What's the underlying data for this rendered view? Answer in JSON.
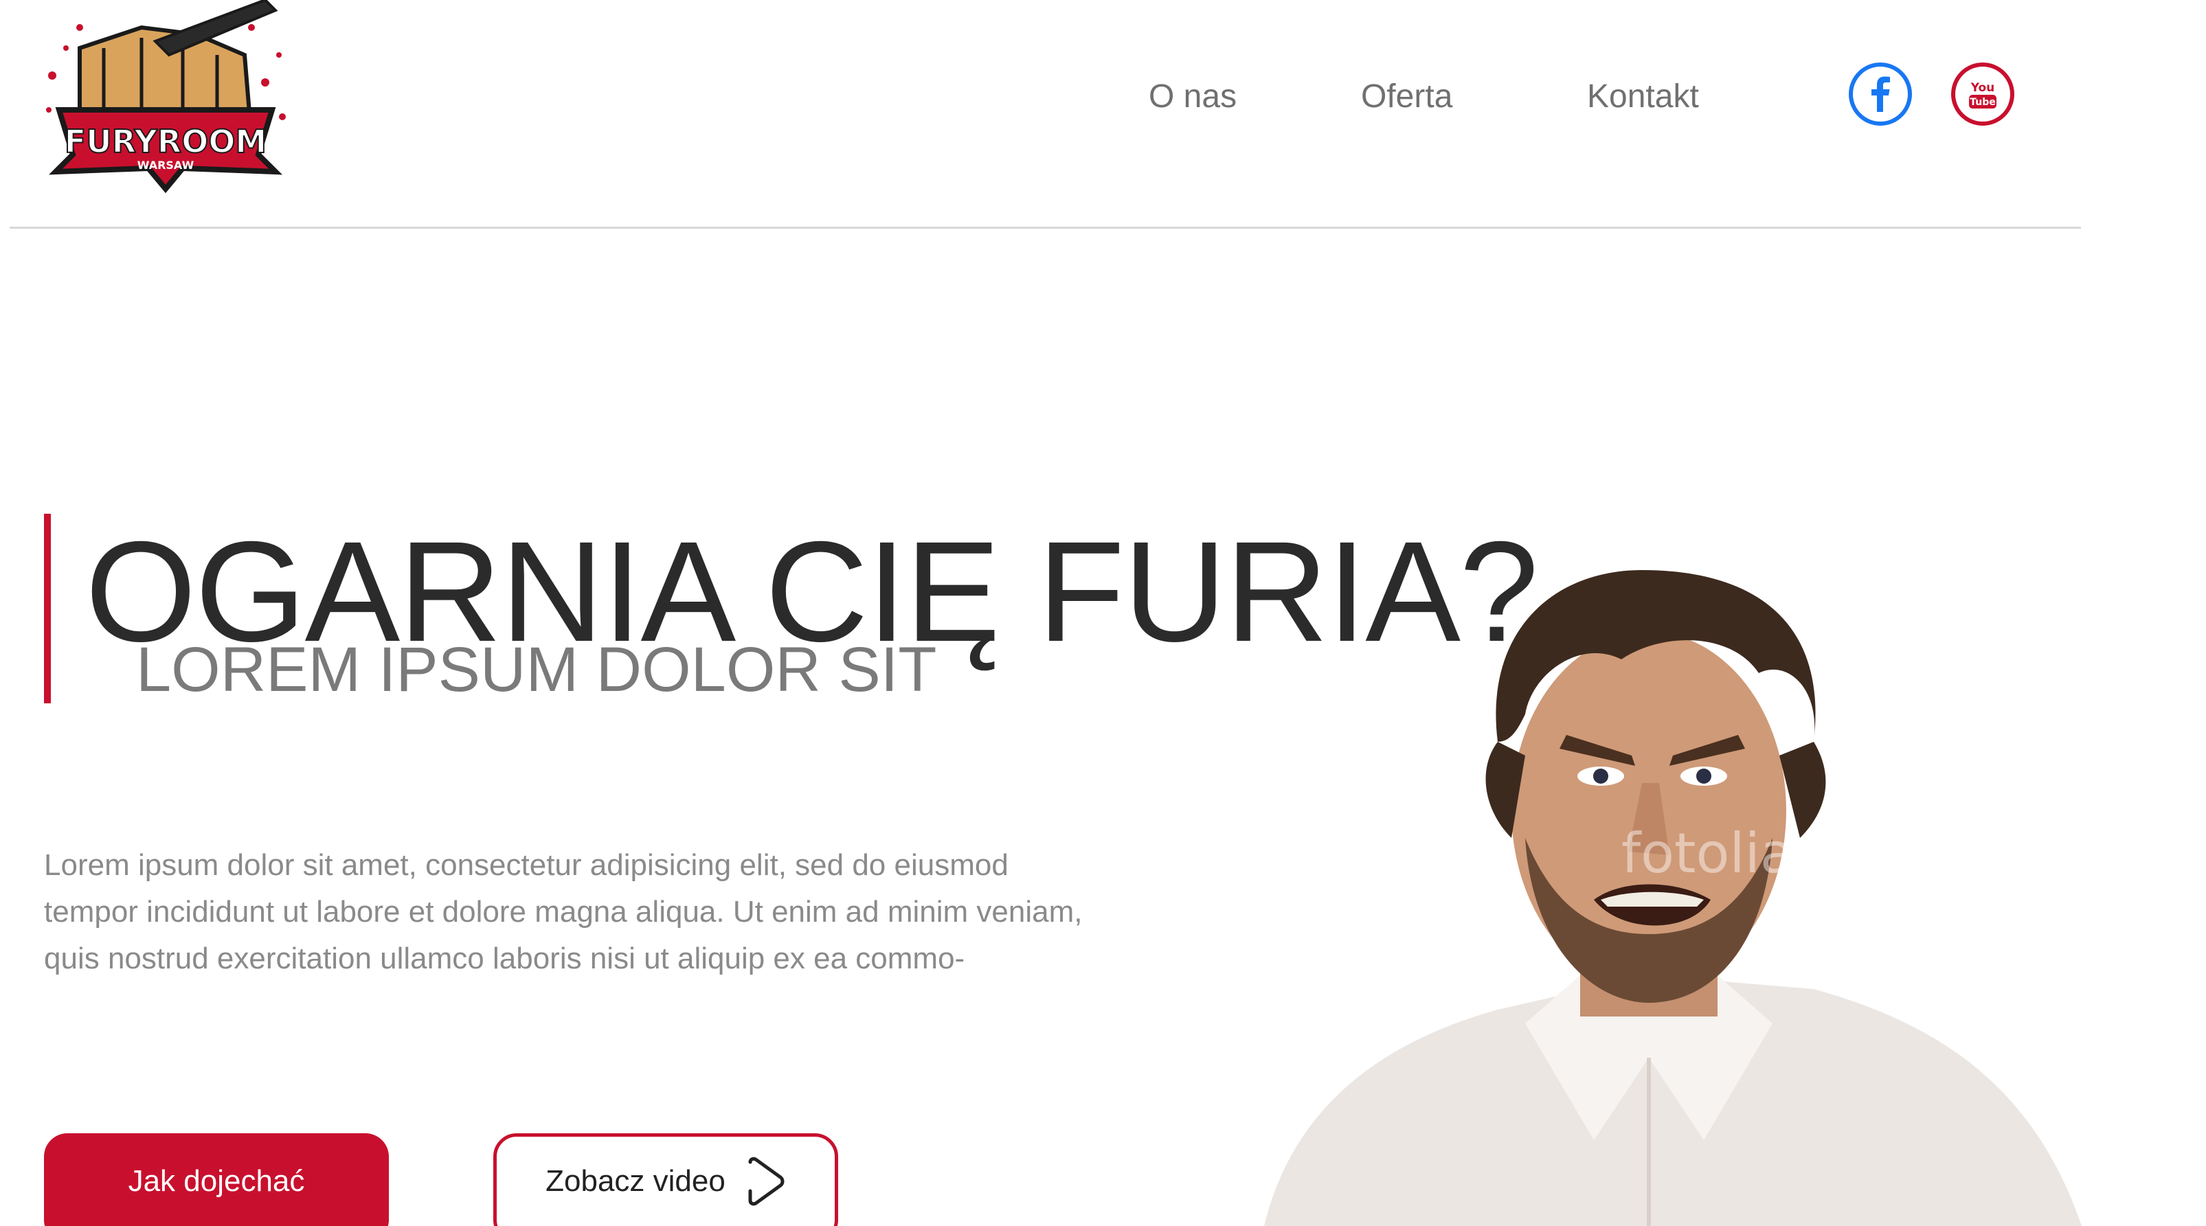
{
  "header": {
    "logo": {
      "text_main": "FURYROOM",
      "text_sub": "WARSAW"
    },
    "nav": [
      {
        "label": "O nas"
      },
      {
        "label": "Oferta"
      },
      {
        "label": "Kontakt"
      }
    ],
    "social": [
      {
        "icon": "facebook-icon",
        "color": "#1877f2"
      },
      {
        "icon": "youtube-icon",
        "color": "#c8102e",
        "text_top": "You",
        "text_bottom": "Tube"
      }
    ]
  },
  "hero": {
    "title": "OGARNIA CIĘ FURIA?",
    "subtitle": "LOREM IPSUM DOLOR SIT",
    "body": "Lorem ipsum dolor sit amet, consectetur adipisicing elit, sed do eiusmod tempor incididunt ut labore et dolore magna aliqua. Ut enim ad minim veniam, quis nostrud exercitation ullamco laboris nisi ut aliquip ex ea commo-",
    "primary_button": "Jak dojechać",
    "secondary_button": "Zobacz video",
    "photo_watermark": "fotolia"
  },
  "colors": {
    "accent": "#c8102e",
    "title": "#2b2b2b",
    "subtitle": "#7a7a7a",
    "body": "#8a8a8a",
    "nav": "#707070"
  }
}
